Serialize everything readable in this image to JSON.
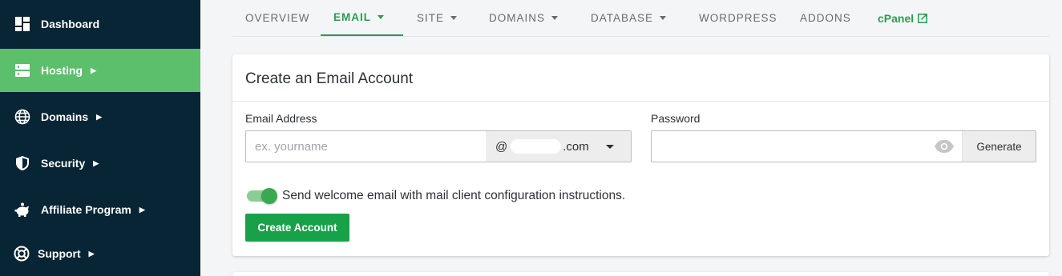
{
  "sidebar": {
    "items": [
      {
        "label": "Dashboard",
        "icon": "dashboard-icon",
        "has_caret": false,
        "active": false
      },
      {
        "label": "Hosting",
        "icon": "server-icon",
        "has_caret": true,
        "active": true
      },
      {
        "label": "Domains",
        "icon": "globe-icon",
        "has_caret": true,
        "active": false
      },
      {
        "label": "Security",
        "icon": "shield-icon",
        "has_caret": true,
        "active": false
      },
      {
        "label": "Affiliate Program",
        "icon": "piggy-bank-icon",
        "has_caret": true,
        "active": false
      },
      {
        "label": "Support",
        "icon": "lifebuoy-icon",
        "has_caret": true,
        "active": false
      }
    ],
    "caret": "▶"
  },
  "tabs": [
    {
      "label": "OVERVIEW"
    },
    {
      "label": "EMAIL"
    },
    {
      "label": "SITE"
    },
    {
      "label": "DOMAINS"
    },
    {
      "label": "DATABASE"
    },
    {
      "label": "WORDPRESS"
    },
    {
      "label": "ADDONS"
    },
    {
      "label": "cPanel"
    }
  ],
  "form": {
    "title": "Create an Email Account",
    "email_label": "Email Address",
    "email_placeholder": "ex. yourname",
    "domain_prefix": "@",
    "domain_suffix": ".com",
    "password_label": "Password",
    "password_value": "",
    "generate_label": "Generate",
    "toggle_on": true,
    "toggle_label": "Send welcome email with mail client configuration instructions.",
    "submit_label": "Create Account"
  },
  "colors": {
    "sidebar_bg": "#082535",
    "sidebar_active": "#5cbf6b",
    "accent_green": "#2a9d4f",
    "button_green": "#17a24a"
  }
}
